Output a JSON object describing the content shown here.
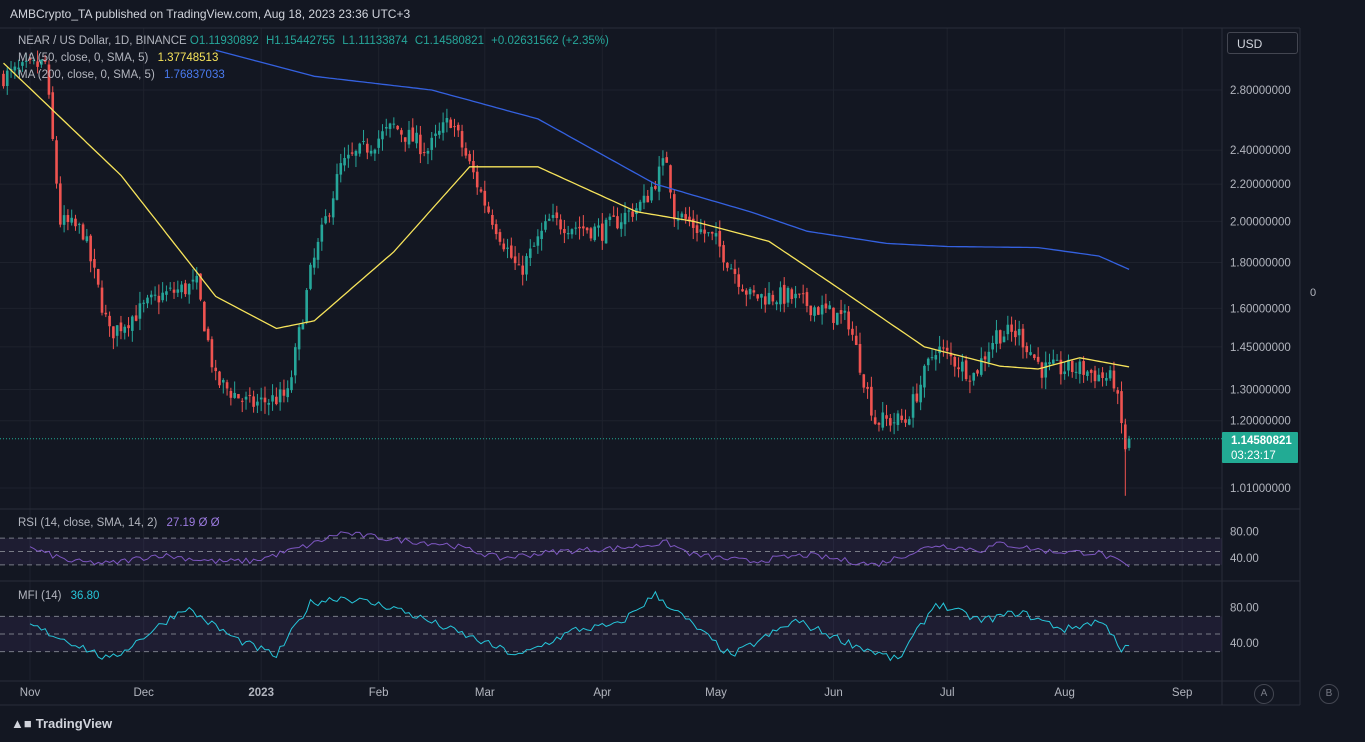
{
  "header": {
    "publisher_line": "AMBCrypto_TA published on TradingView.com, Aug 18, 2023 23:36 UTC+3"
  },
  "main_legend": {
    "symbol": "NEAR / US Dollar, 1D, BINANCE",
    "open": "O1.11930892",
    "high": "H1.15442755",
    "low": "L1.11133874",
    "close": "C1.14580821",
    "change": "+0.02631562 (+2.35%)"
  },
  "indicators": {
    "ma50": {
      "label": "MA (50, close, 0, SMA, 5)",
      "value": "1.37748513",
      "color": "#f7e45b"
    },
    "ma200": {
      "label": "MA (200, close, 0, SMA, 5)",
      "value": "1.76837033",
      "color": "#3461e0"
    },
    "rsi": {
      "label": "RSI (14, close, SMA, 14, 2)",
      "value": "27.19  Ø  Ø",
      "color": "#7e57c2"
    },
    "mfi": {
      "label": "MFI (14)",
      "value": "36.80",
      "color": "#26c6da"
    }
  },
  "currency_button": "USD",
  "last_price": {
    "value": "1.14580821",
    "countdown": "03:23:17",
    "color": "#22ab94"
  },
  "right_pane_zero": "0",
  "scale_buttons": {
    "a": "A",
    "b": "B"
  },
  "branding": "TradingView",
  "colors": {
    "background": "#131722",
    "up": "#26a69a",
    "down": "#ef5350",
    "grid": "#1e222d"
  },
  "chart_data": {
    "type": "candlestick",
    "price_axis_ticks": [
      "2.80000000",
      "2.40000000",
      "2.20000000",
      "2.00000000",
      "1.80000000",
      "1.60000000",
      "1.45000000",
      "1.30000000",
      "1.20000000",
      "1.01000000"
    ],
    "price_axis_values": [
      2.8,
      2.4,
      2.2,
      2.0,
      1.8,
      1.6,
      1.45,
      1.3,
      1.2,
      1.01
    ],
    "price_range": [
      0.95,
      3.05
    ],
    "log_scale": true,
    "time_axis_labels": [
      "Nov",
      "Dec",
      "2023",
      "Feb",
      "Mar",
      "Apr",
      "May",
      "Jun",
      "Jul",
      "Aug",
      "Sep"
    ],
    "rsi_axis_ticks": [
      "80.00",
      "40.00"
    ],
    "mfi_axis_ticks": [
      "80.00",
      "40.00"
    ],
    "price_anchors": [
      {
        "date": "2022-10-25",
        "close": 2.9
      },
      {
        "date": "2022-11-05",
        "close": 3.0
      },
      {
        "date": "2022-11-09",
        "close": 2.0
      },
      {
        "date": "2022-11-15",
        "close": 1.95
      },
      {
        "date": "2022-11-22",
        "close": 1.5
      },
      {
        "date": "2022-12-05",
        "close": 1.65
      },
      {
        "date": "2022-12-15",
        "close": 1.7
      },
      {
        "date": "2022-12-20",
        "close": 1.33
      },
      {
        "date": "2022-12-29",
        "close": 1.25
      },
      {
        "date": "2023-01-08",
        "close": 1.28
      },
      {
        "date": "2023-01-14",
        "close": 1.75
      },
      {
        "date": "2023-01-22",
        "close": 2.3
      },
      {
        "date": "2023-02-05",
        "close": 2.55
      },
      {
        "date": "2023-02-14",
        "close": 2.4
      },
      {
        "date": "2023-02-20",
        "close": 2.6
      },
      {
        "date": "2023-03-01",
        "close": 2.1
      },
      {
        "date": "2023-03-10",
        "close": 1.75
      },
      {
        "date": "2023-03-18",
        "close": 2.0
      },
      {
        "date": "2023-04-01",
        "close": 1.95
      },
      {
        "date": "2023-04-12",
        "close": 2.1
      },
      {
        "date": "2023-04-18",
        "close": 2.35
      },
      {
        "date": "2023-04-20",
        "close": 2.05
      },
      {
        "date": "2023-05-01",
        "close": 1.9
      },
      {
        "date": "2023-05-10",
        "close": 1.65
      },
      {
        "date": "2023-05-20",
        "close": 1.65
      },
      {
        "date": "2023-06-05",
        "close": 1.55
      },
      {
        "date": "2023-06-12",
        "close": 1.2
      },
      {
        "date": "2023-06-20",
        "close": 1.2
      },
      {
        "date": "2023-06-28",
        "close": 1.45
      },
      {
        "date": "2023-07-08",
        "close": 1.35
      },
      {
        "date": "2023-07-14",
        "close": 1.5
      },
      {
        "date": "2023-07-20",
        "close": 1.5
      },
      {
        "date": "2023-07-26",
        "close": 1.37
      },
      {
        "date": "2023-08-05",
        "close": 1.37
      },
      {
        "date": "2023-08-14",
        "close": 1.33
      },
      {
        "date": "2023-08-17",
        "close": 1.12
      },
      {
        "date": "2023-08-18",
        "close": 1.1458
      }
    ],
    "ma50_anchors": [
      {
        "date": "2022-10-25",
        "value": 3.0
      },
      {
        "date": "2022-11-25",
        "value": 2.25
      },
      {
        "date": "2022-12-20",
        "value": 1.65
      },
      {
        "date": "2023-01-05",
        "value": 1.52
      },
      {
        "date": "2023-01-15",
        "value": 1.55
      },
      {
        "date": "2023-02-05",
        "value": 1.85
      },
      {
        "date": "2023-02-25",
        "value": 2.3
      },
      {
        "date": "2023-03-15",
        "value": 2.3
      },
      {
        "date": "2023-04-10",
        "value": 2.05
      },
      {
        "date": "2023-04-25",
        "value": 2.0
      },
      {
        "date": "2023-05-15",
        "value": 1.9
      },
      {
        "date": "2023-06-01",
        "value": 1.7
      },
      {
        "date": "2023-06-25",
        "value": 1.45
      },
      {
        "date": "2023-07-15",
        "value": 1.38
      },
      {
        "date": "2023-07-25",
        "value": 1.37
      },
      {
        "date": "2023-08-05",
        "value": 1.41
      },
      {
        "date": "2023-08-18",
        "value": 1.3775
      }
    ],
    "ma200_anchors": [
      {
        "date": "2022-12-20",
        "value": 3.1
      },
      {
        "date": "2023-01-15",
        "value": 2.9
      },
      {
        "date": "2023-02-15",
        "value": 2.8
      },
      {
        "date": "2023-03-15",
        "value": 2.6
      },
      {
        "date": "2023-04-15",
        "value": 2.2
      },
      {
        "date": "2023-05-10",
        "value": 2.05
      },
      {
        "date": "2023-05-25",
        "value": 1.95
      },
      {
        "date": "2023-06-15",
        "value": 1.89
      },
      {
        "date": "2023-07-01",
        "value": 1.875
      },
      {
        "date": "2023-07-25",
        "value": 1.87
      },
      {
        "date": "2023-08-10",
        "value": 1.83
      },
      {
        "date": "2023-08-18",
        "value": 1.7684
      }
    ],
    "rsi_anchors": [
      {
        "date": "2022-11-01",
        "value": 55
      },
      {
        "date": "2022-11-12",
        "value": 35
      },
      {
        "date": "2022-11-22",
        "value": 32
      },
      {
        "date": "2022-12-05",
        "value": 45
      },
      {
        "date": "2022-12-20",
        "value": 35
      },
      {
        "date": "2022-12-30",
        "value": 36
      },
      {
        "date": "2023-01-14",
        "value": 60
      },
      {
        "date": "2023-01-22",
        "value": 78
      },
      {
        "date": "2023-02-05",
        "value": 68
      },
      {
        "date": "2023-02-20",
        "value": 60
      },
      {
        "date": "2023-03-05",
        "value": 40
      },
      {
        "date": "2023-03-20",
        "value": 50
      },
      {
        "date": "2023-04-05",
        "value": 55
      },
      {
        "date": "2023-04-18",
        "value": 63
      },
      {
        "date": "2023-04-25",
        "value": 45
      },
      {
        "date": "2023-05-10",
        "value": 35
      },
      {
        "date": "2023-05-25",
        "value": 45
      },
      {
        "date": "2023-06-12",
        "value": 30
      },
      {
        "date": "2023-06-28",
        "value": 60
      },
      {
        "date": "2023-07-10",
        "value": 52
      },
      {
        "date": "2023-07-15",
        "value": 62
      },
      {
        "date": "2023-07-28",
        "value": 50
      },
      {
        "date": "2023-08-10",
        "value": 48
      },
      {
        "date": "2023-08-18",
        "value": 27.19
      }
    ],
    "mfi_anchors": [
      {
        "date": "2022-11-01",
        "value": 60
      },
      {
        "date": "2022-11-15",
        "value": 35
      },
      {
        "date": "2022-11-22",
        "value": 20
      },
      {
        "date": "2022-12-12",
        "value": 80
      },
      {
        "date": "2022-12-25",
        "value": 45
      },
      {
        "date": "2023-01-05",
        "value": 25
      },
      {
        "date": "2023-01-14",
        "value": 85
      },
      {
        "date": "2023-01-22",
        "value": 92
      },
      {
        "date": "2023-02-05",
        "value": 80
      },
      {
        "date": "2023-02-20",
        "value": 55
      },
      {
        "date": "2023-03-10",
        "value": 25
      },
      {
        "date": "2023-03-25",
        "value": 55
      },
      {
        "date": "2023-04-05",
        "value": 60
      },
      {
        "date": "2023-04-15",
        "value": 95
      },
      {
        "date": "2023-04-25",
        "value": 60
      },
      {
        "date": "2023-05-05",
        "value": 25
      },
      {
        "date": "2023-05-22",
        "value": 65
      },
      {
        "date": "2023-06-05",
        "value": 40
      },
      {
        "date": "2023-06-18",
        "value": 20
      },
      {
        "date": "2023-06-28",
        "value": 85
      },
      {
        "date": "2023-07-10",
        "value": 65
      },
      {
        "date": "2023-07-20",
        "value": 75
      },
      {
        "date": "2023-08-01",
        "value": 55
      },
      {
        "date": "2023-08-10",
        "value": 65
      },
      {
        "date": "2023-08-14",
        "value": 50
      },
      {
        "date": "2023-08-16",
        "value": 30
      },
      {
        "date": "2023-08-18",
        "value": 36.8
      }
    ]
  }
}
